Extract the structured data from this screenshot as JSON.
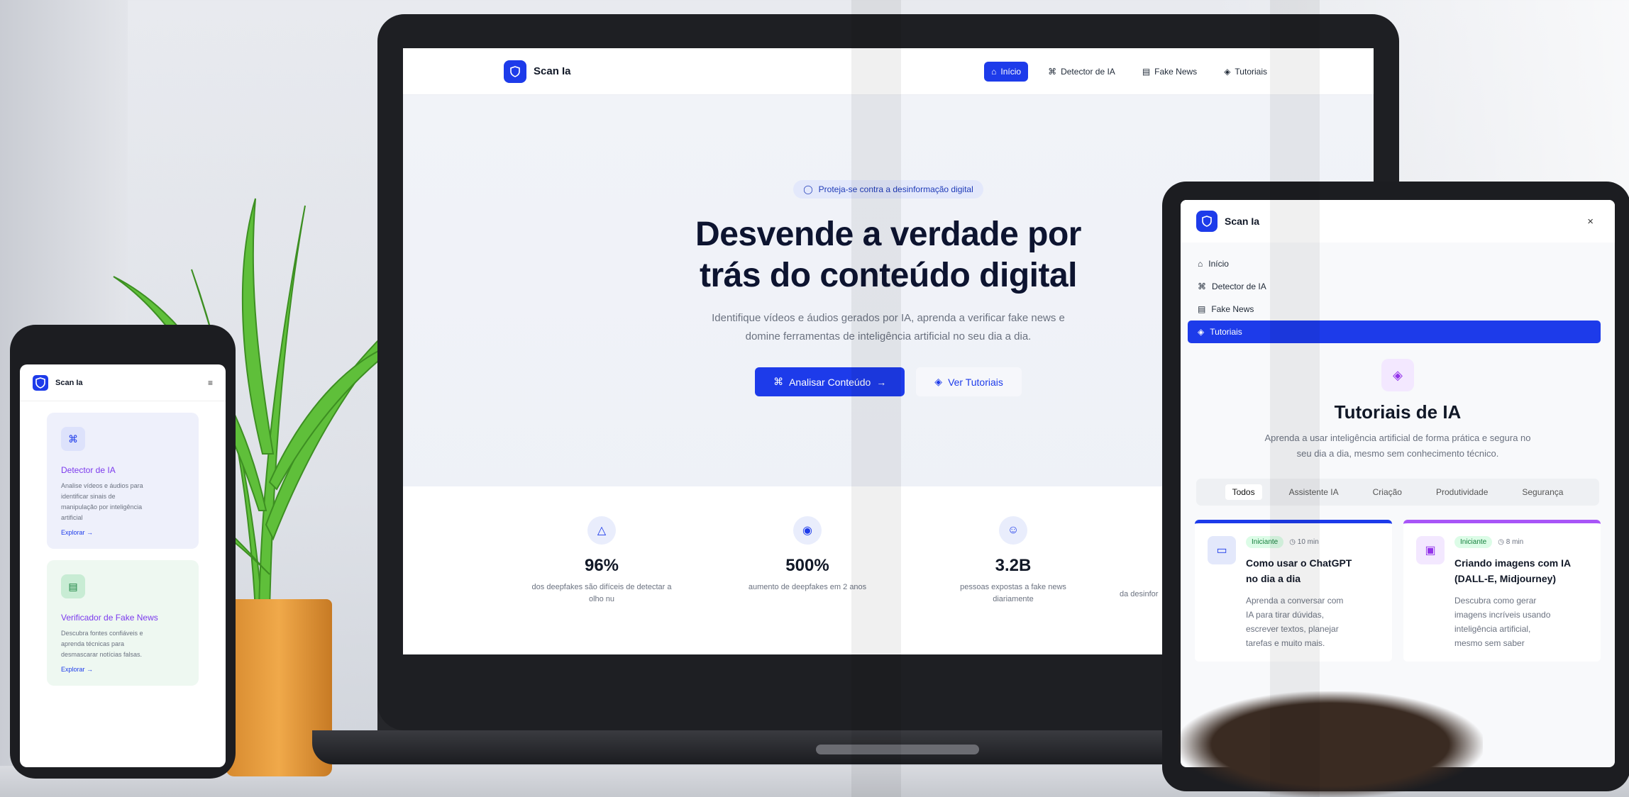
{
  "colors": {
    "accent": "#1d3bea",
    "purple": "#7c3aed",
    "green_badge": "#15803d",
    "pot": "#f0a94a"
  },
  "laptop": {
    "brand": "Scan Ia",
    "nav": [
      {
        "label": "Início",
        "icon": "home-icon",
        "active": true
      },
      {
        "label": "Detector de IA",
        "icon": "scan-icon",
        "active": false
      },
      {
        "label": "Fake News",
        "icon": "newspaper-icon",
        "active": false
      },
      {
        "label": "Tutoriais",
        "icon": "graduation-cap-icon",
        "active": false
      }
    ],
    "hero": {
      "pill": "Proteja-se contra a desinformação digital",
      "title_line1": "Desvende a verdade por",
      "title_line2": "trás do conteúdo digital",
      "subtitle_line1": "Identifique vídeos e áudios gerados por IA, aprenda a verificar fake news e",
      "subtitle_line2": "domine ferramentas de inteligência artificial no seu dia a dia.",
      "primary_btn": "Analisar Conteúdo",
      "secondary_btn": "Ver Tutoriais"
    },
    "stats": [
      {
        "value": "96%",
        "label_line1": "dos deepfakes são difíceis de detectar a",
        "label_line2": "olho nu",
        "icon": "warning-icon"
      },
      {
        "value": "500%",
        "label_line1": "aumento de deepfakes em 2 anos",
        "label_line2": "",
        "icon": "eye-icon"
      },
      {
        "value": "3.2B",
        "label_line1": "pessoas expostas a fake news",
        "label_line2": "diariamente",
        "icon": "users-icon"
      },
      {
        "value": "",
        "label_line1": "da desinfor",
        "label_line2": "",
        "icon": ""
      }
    ]
  },
  "phone": {
    "brand": "Scan Ia",
    "menu_icon": "≡",
    "cards": [
      {
        "title": "Detector de IA",
        "desc_line1": "Analise vídeos e áudios para",
        "desc_line2": "identificar sinais de",
        "desc_line3": "manipulação por inteligência",
        "desc_line4": "artificial",
        "link": "Explorar",
        "icon": "scan-icon"
      },
      {
        "title": "Verificador de Fake News",
        "desc_line1": "Descubra fontes confiáveis e",
        "desc_line2": "aprenda técnicas para",
        "desc_line3": "desmascarar notícias falsas.",
        "desc_line4": "",
        "link": "Explorar",
        "icon": "newspaper-icon"
      }
    ]
  },
  "tablet": {
    "brand": "Scan Ia",
    "close": "×",
    "menu": [
      {
        "label": "Início",
        "icon": "home-icon",
        "active": false
      },
      {
        "label": "Detector de IA",
        "icon": "scan-icon",
        "active": false
      },
      {
        "label": "Fake News",
        "icon": "newspaper-icon",
        "active": false
      },
      {
        "label": "Tutoriais",
        "icon": "graduation-cap-icon",
        "active": true
      }
    ],
    "heading": "Tutoriais de IA",
    "desc_line1": "Aprenda a usar inteligência artificial de forma prática e segura no",
    "desc_line2": "seu dia a dia, mesmo sem conhecimento técnico.",
    "tabs": [
      "Todos",
      "Assistente IA",
      "Criação",
      "Produtividade",
      "Segurança"
    ],
    "active_tab": "Todos",
    "cards": [
      {
        "badge": "Iniciante",
        "time": "10 min",
        "title_line1": "Como usar o ChatGPT",
        "title_line2": "no dia a dia",
        "desc_line1": "Aprenda a conversar com",
        "desc_line2": "IA para tirar dúvidas,",
        "desc_line3": "escrever textos, planejar",
        "desc_line4": "tarefas e muito mais.",
        "icon": "chat-icon"
      },
      {
        "badge": "Iniciante",
        "time": "8 min",
        "title_line1": "Criando imagens com IA",
        "title_line2": "(DALL-E, Midjourney)",
        "desc_line1": "Descubra como gerar",
        "desc_line2": "imagens incríveis usando",
        "desc_line3": "inteligência artificial,",
        "desc_line4": "mesmo sem saber",
        "icon": "image-icon"
      }
    ]
  }
}
